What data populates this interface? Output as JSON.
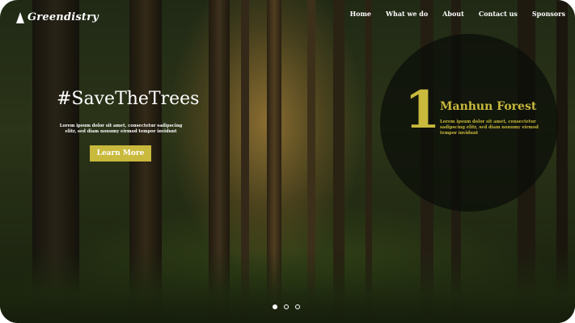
{
  "brand": {
    "name": "Greendistry",
    "icon": "tree-icon"
  },
  "nav": {
    "items": [
      "Home",
      "What we do",
      "About",
      "Contact us",
      "Sponsors"
    ]
  },
  "hero": {
    "title": "#SaveTheTrees",
    "text": "Lorem ipsum dolor sit amet, consectetur sadipscing elitr, sed diam nonumy eirmod tempor invidunt",
    "button_label": "Learn More"
  },
  "feature": {
    "number": "1",
    "title": "Manhun Forest",
    "text": "Lorem ipsum dolor sit amet, consectetur sadipscing elitr, sed diam nonumy eirmod tempor invidunt"
  },
  "carousel": {
    "slides": 3,
    "active": 0
  },
  "colors": {
    "accent": "#c9b93c",
    "text": "#ffffff",
    "overlay": "#0a0c08"
  }
}
